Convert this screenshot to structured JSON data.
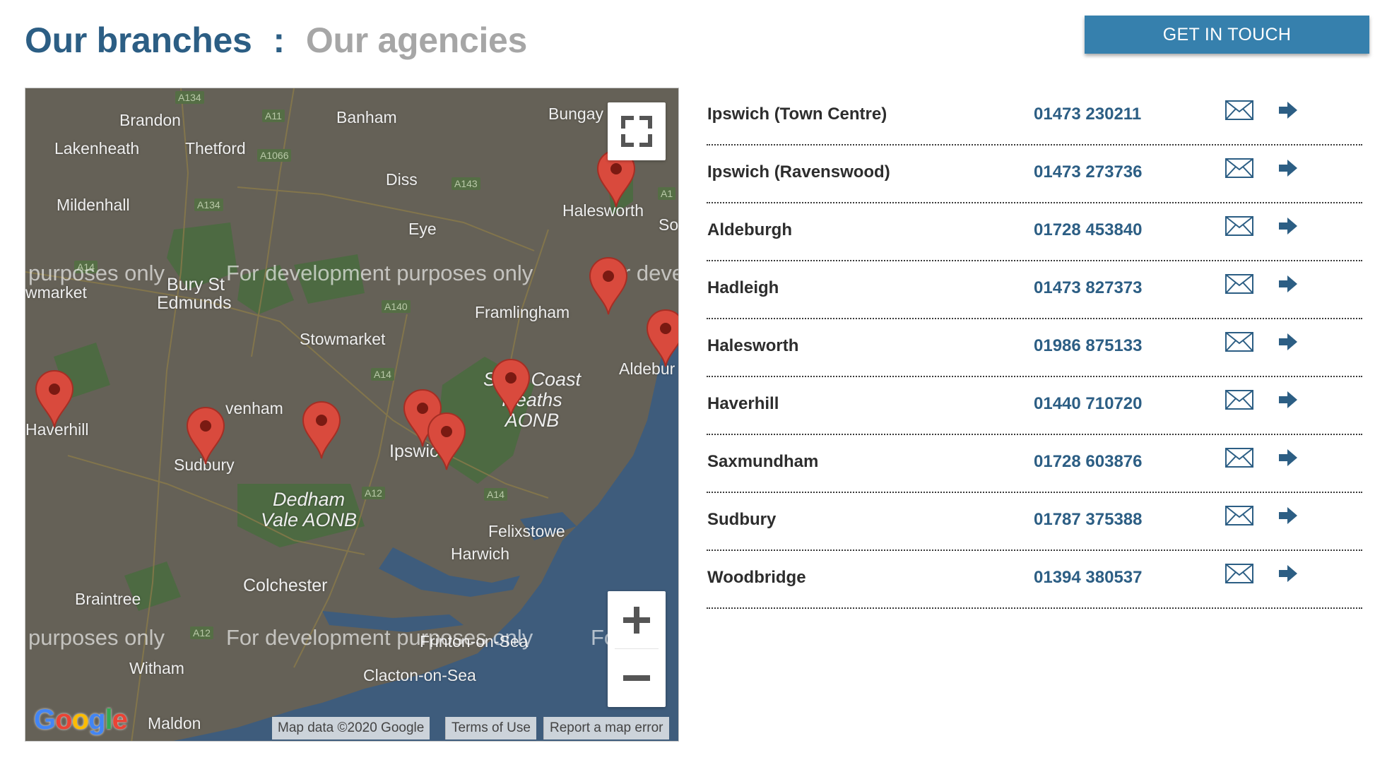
{
  "header": {
    "title_branches": "Our branches",
    "separator": ":",
    "title_agencies": "Our agencies",
    "cta_label": "GET IN TOUCH"
  },
  "map": {
    "places": {
      "brandon": "Brandon",
      "banham": "Banham",
      "bungay": "Bungay",
      "lakenheath": "Lakenheath",
      "thetford": "Thetford",
      "diss": "Diss",
      "mildenhall": "Mildenhall",
      "halesworth": "Halesworth",
      "so": "So",
      "eye": "Eye",
      "newmarket": "wmarket",
      "bury_st": "Bury St",
      "edmunds": "Edmunds",
      "framlingham": "Framlingham",
      "stowmarket": "Stowmarket",
      "aldeburgh": "Aldebur",
      "haverhill": "Haverhill",
      "lavenham": "venham",
      "sudbury": "Sudbury",
      "ipswich": "Ipswic",
      "suffolk_coast": "S   lk Coast\nHeaths\nAONB",
      "dedham": "Dedham\nVale AONB",
      "felixstowe": "Felixstowe",
      "harwich": "Harwich",
      "colchester": "Colchester",
      "braintree": "Braintree",
      "frinton": "Frinton-on-Sea",
      "witham": "Witham",
      "clacton": "Clacton-on-Sea",
      "maldon": "Maldon"
    },
    "roads": {
      "a134a": "A134",
      "a11": "A11",
      "a1066": "A1066",
      "a143": "A143",
      "a134b": "A134",
      "a14a": "A14",
      "a140": "A140",
      "a14b": "A14",
      "a12a": "A12",
      "a14c": "A14",
      "a12b": "A12",
      "a1x": "A1"
    },
    "dev_watermark": {
      "left": "purposes only",
      "center": "For development purposes only",
      "right": "r devel",
      "right2": "Fo        el"
    },
    "logo": "Google",
    "attribution": {
      "map_data": "Map data ©2020 Google",
      "terms": "Terms of Use",
      "report": "Report a map error"
    },
    "pin_color": "#d94a3d",
    "land_color": "#656157",
    "sea_color": "#3e5c7c",
    "park_color": "#4b6b44"
  },
  "branches": [
    {
      "name": "Ipswich (Town Centre)",
      "phone": "01473 230211"
    },
    {
      "name": "Ipswich (Ravenswood)",
      "phone": "01473 273736"
    },
    {
      "name": "Aldeburgh",
      "phone": "01728 453840"
    },
    {
      "name": "Hadleigh",
      "phone": "01473 827373"
    },
    {
      "name": "Halesworth",
      "phone": "01986 875133"
    },
    {
      "name": "Haverhill",
      "phone": "01440 710720"
    },
    {
      "name": "Saxmundham",
      "phone": "01728 603876"
    },
    {
      "name": "Sudbury",
      "phone": "01787 375388"
    },
    {
      "name": "Woodbridge",
      "phone": "01394 380537"
    }
  ],
  "icons": {
    "email": "envelope-icon",
    "directions": "arrow-right-icon"
  },
  "colors": {
    "brand": "#2c5e84",
    "cta": "#3680ad",
    "muted": "#a6a6a6"
  }
}
